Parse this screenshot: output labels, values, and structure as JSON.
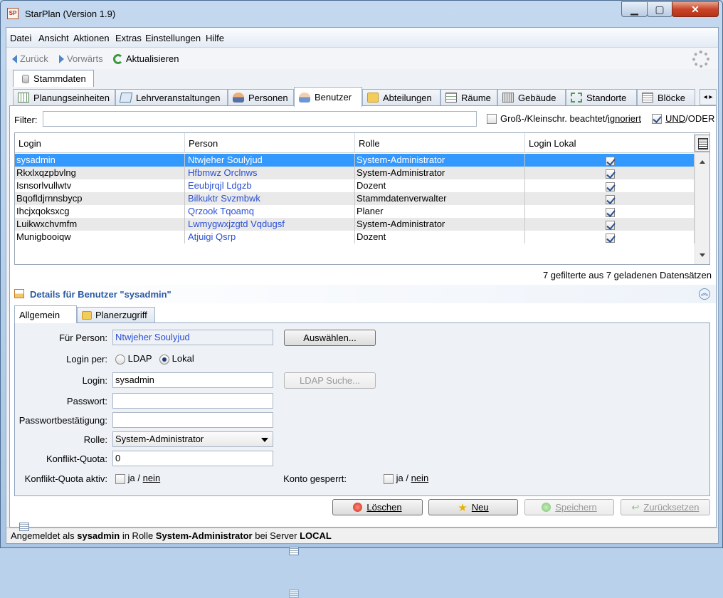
{
  "window": {
    "title": "StarPlan (Version 1.9)",
    "app_icon": "SP"
  },
  "menu": [
    "Datei",
    "Ansicht",
    "Aktionen",
    "Extras",
    "Einstellungen",
    "Hilfe"
  ],
  "nav": {
    "back": "Zurück",
    "forward": "Vorwärts",
    "refresh": "Aktualisieren"
  },
  "top_tab": "Stammdaten",
  "tabs": [
    "Planungseinheiten",
    "Lehrveranstaltungen",
    "Personen",
    "Benutzer",
    "Abteilungen",
    "Räume",
    "Gebäude",
    "Standorte",
    "Blöcke"
  ],
  "filter": {
    "label": "Filter:",
    "value": "",
    "case_label": "Groß-/Kleinschr. beachtet/",
    "case_link": "ignoriert",
    "and_label": "UND",
    "or_label": "/ODER"
  },
  "table": {
    "columns": [
      "Login",
      "Person",
      "Rolle",
      "Login Lokal"
    ],
    "rows": [
      {
        "login": "sysadmin",
        "person": "Ntwjeher Soulyjud",
        "role": "System-Administrator"
      },
      {
        "login": "Rkxlxqzpbvlng",
        "person": "Hfbmwz Orclnws",
        "role": "System-Administrator"
      },
      {
        "login": "Isnsorlvullwtv",
        "person": "Eeubjrqjl Ldgzb",
        "role": "Dozent"
      },
      {
        "login": "Bqofldjrnnsbycp",
        "person": "Bilkuktr Svzmbwk",
        "role": "Stammdatenverwalter"
      },
      {
        "login": "Ihcjxqoksxcg",
        "person": "Qrzook Tqoamq",
        "role": "Planer"
      },
      {
        "login": "Luikwxchvmfm",
        "person": "Lwmygwxjzgtd Vqdugsf",
        "role": "System-Administrator"
      },
      {
        "login": "Munigbooiqw",
        "person": "Atjuigi Qsrp",
        "role": "Dozent"
      }
    ]
  },
  "count_text": "7 gefilterte aus 7 geladenen Datensätzen",
  "details": {
    "title": "Details für Benutzer \"sysadmin\"",
    "tabs": [
      "Allgemein",
      "Planerzugriff"
    ],
    "labels": {
      "person": "Für Person:",
      "login_via": "Login per:",
      "login": "Login:",
      "password": "Passwort:",
      "password_confirm": "Passwortbestätigung:",
      "role": "Rolle:",
      "quota": "Konflikt-Quota:",
      "quota_active": "Konflikt-Quota aktiv:",
      "account_locked": "Konto gesperrt:"
    },
    "values": {
      "person": "Ntwjeher Soulyjud",
      "login": "sysadmin",
      "password": "",
      "password_confirm": "",
      "role": "System-Administrator",
      "quota": "0"
    },
    "radio": {
      "ldap": "LDAP",
      "local": "Lokal"
    },
    "yes": "ja /",
    "no": "nein",
    "buttons": {
      "select": "Auswählen...",
      "ldap_search": "LDAP Suche..."
    }
  },
  "actions": {
    "delete": "Löschen",
    "new": "Neu",
    "save": "Speichern",
    "reset": "Zurücksetzen"
  },
  "status": {
    "prefix": "Angemeldet als ",
    "user": "sysadmin",
    "mid": " in Rolle ",
    "role": "System-Administrator",
    "mid2": " bei Server ",
    "server": "LOCAL"
  }
}
